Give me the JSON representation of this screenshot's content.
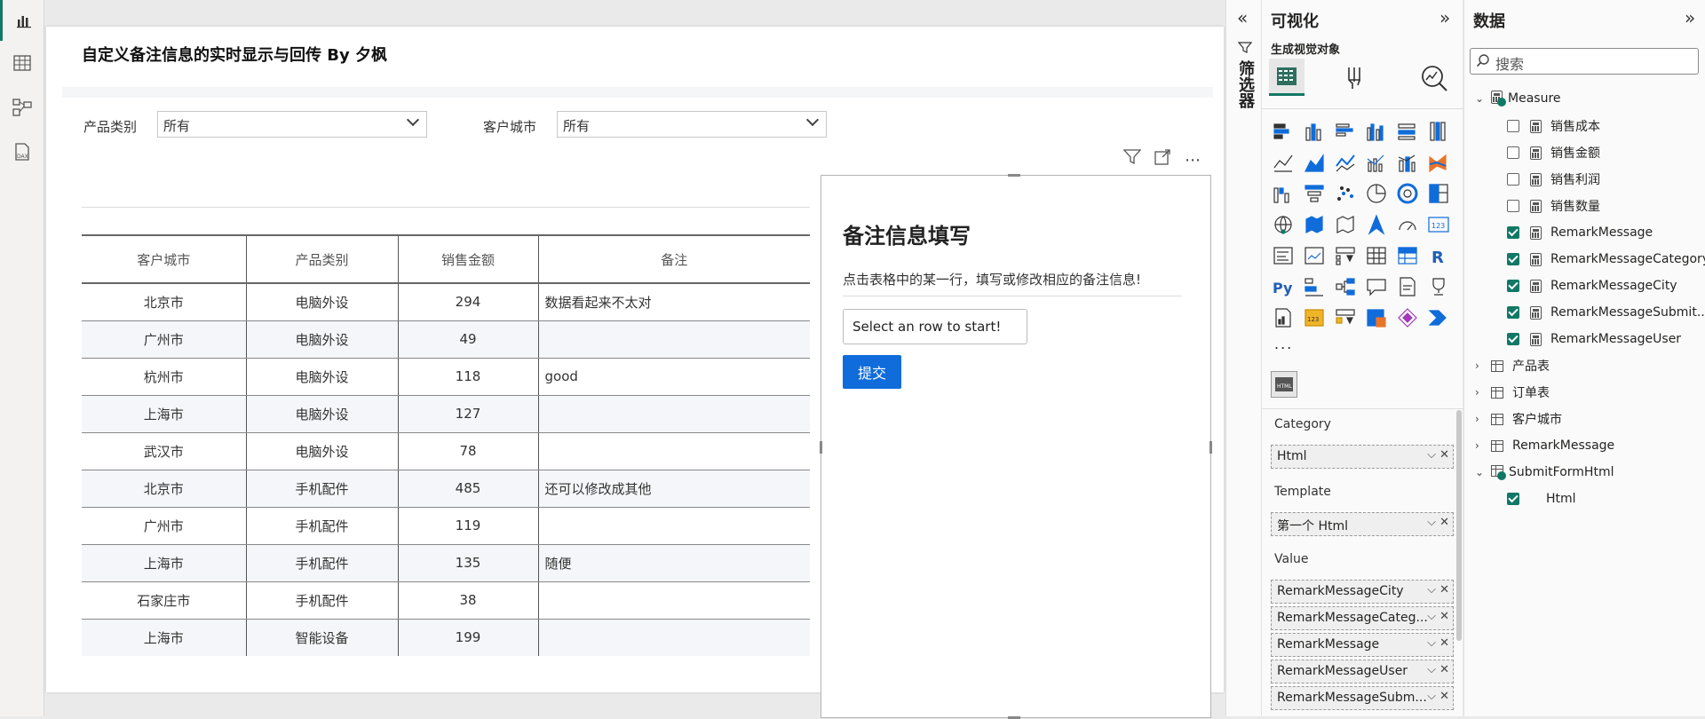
{
  "report": {
    "title": "自定义备注信息的实时显示与回传 By 夕枫"
  },
  "slicers": [
    {
      "label": "产品类别",
      "value": "所有"
    },
    {
      "label": "客户城市",
      "value": "所有"
    }
  ],
  "table": {
    "columns": [
      "客户城市",
      "产品类别",
      "销售金额",
      "备注"
    ],
    "rows": [
      [
        "北京市",
        "电脑外设",
        "294",
        "数据看起来不太对"
      ],
      [
        "广州市",
        "电脑外设",
        "49",
        ""
      ],
      [
        "杭州市",
        "电脑外设",
        "118",
        "good"
      ],
      [
        "上海市",
        "电脑外设",
        "127",
        ""
      ],
      [
        "武汉市",
        "电脑外设",
        "78",
        ""
      ],
      [
        "北京市",
        "手机配件",
        "485",
        "还可以修改成其他"
      ],
      [
        "广州市",
        "手机配件",
        "119",
        ""
      ],
      [
        "上海市",
        "手机配件",
        "135",
        "随便"
      ],
      [
        "石家庄市",
        "手机配件",
        "38",
        ""
      ],
      [
        "上海市",
        "智能设备",
        "199",
        ""
      ]
    ]
  },
  "form": {
    "heading": "备注信息填写",
    "instruction": "点击表格中的某一行，填写或修改相应的备注信息!",
    "input_value": "Select an row to start!",
    "submit_label": "提交"
  },
  "filters_pane": {
    "label": "筛选器"
  },
  "viz_pane": {
    "title": "可视化",
    "subtitle": "生成视觉对象",
    "more": "...",
    "wells": [
      {
        "label": "Category",
        "fields": [
          "Html"
        ]
      },
      {
        "label": "Template",
        "fields": [
          "第一个 Html"
        ]
      },
      {
        "label": "Value",
        "fields": [
          "RemarkMessageCity",
          "RemarkMessageCateg...",
          "RemarkMessage",
          "RemarkMessageUser",
          "RemarkMessageSubm..."
        ]
      }
    ]
  },
  "data_pane": {
    "title": "数据",
    "search_placeholder": "搜索",
    "measure_table": "Measure",
    "measures": [
      {
        "name": "销售成本",
        "checked": false
      },
      {
        "name": "销售金额",
        "checked": false
      },
      {
        "name": "销售利润",
        "checked": false
      },
      {
        "name": "销售数量",
        "checked": false
      },
      {
        "name": "RemarkMessage",
        "checked": true
      },
      {
        "name": "RemarkMessageCategory",
        "checked": true
      },
      {
        "name": "RemarkMessageCity",
        "checked": true
      },
      {
        "name": "RemarkMessageSubmit...",
        "checked": true
      },
      {
        "name": "RemarkMessageUser",
        "checked": true
      }
    ],
    "tables": [
      "产品表",
      "订单表",
      "客户城市",
      "RemarkMessage"
    ],
    "submit_table": "SubmitFormHtml",
    "submit_fields": [
      {
        "name": "Html",
        "checked": true
      }
    ]
  },
  "colors": {
    "accent": "#117865",
    "button": "#0f6cda"
  }
}
